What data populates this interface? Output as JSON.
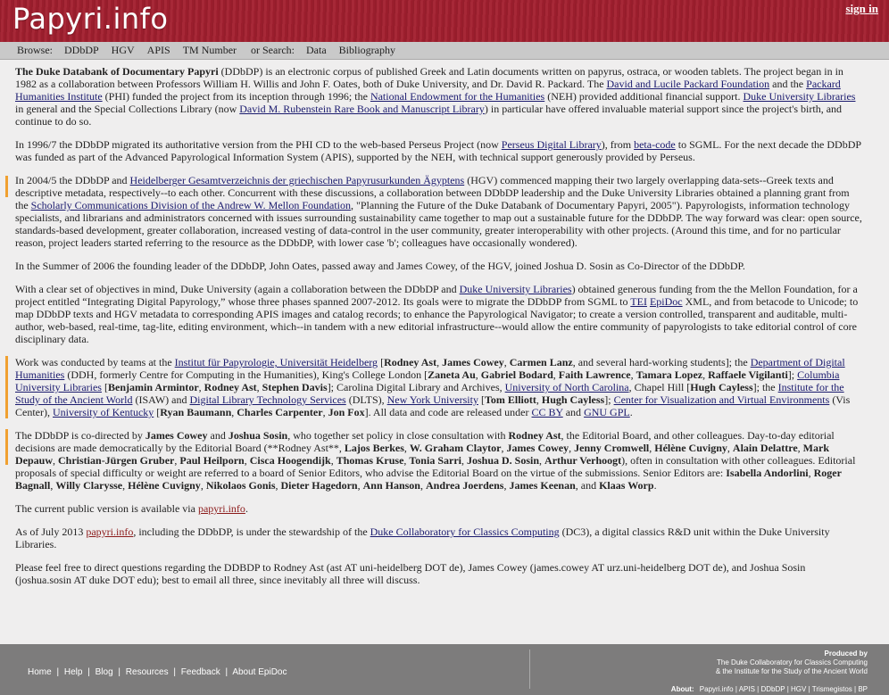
{
  "header": {
    "logo": "Papyri.info",
    "signin": "sign in"
  },
  "nav": {
    "browse_label": "Browse:",
    "items": [
      "DDbDP",
      "HGV",
      "APIS",
      "TM Number"
    ],
    "or_label": "or Search:",
    "search_items": [
      "Data",
      "Bibliography"
    ]
  },
  "content": {
    "p1": {
      "t0": "The Duke Databank of Documentary Papyri",
      "t1": " (DDbDP) is an electronic corpus of published Greek and Latin documents written on papyrus, ostraca, or wooden tablets. The project began in in 1982 as a collaboration between Professors William H. Willis and John F. Oates, both of Duke University, and Dr. David R. Packard. The ",
      "l1": "David and Lucile Packard Foundation",
      "t2": " and the ",
      "l2": "Packard Humanities Institute",
      "t3": " (PHI) funded the project from its inception through 1996; the ",
      "l3": "National Endowment for the Humanities",
      "t4": " (NEH) provided additional financial support. ",
      "l4": "Duke University Libraries",
      "t5": " in general and the Special Collections Library (now ",
      "l5": "David M. Rubenstein Rare Book and Manuscript Library",
      "t6": ") in particular have offered invaluable material support since the project's birth, and continue to do so."
    },
    "p2": {
      "t0": "In 1996/7 the DDbDP migrated its authoritative version from the PHI CD to the web-based Perseus Project (now ",
      "l1": "Perseus Digital Library",
      "t1": "), from ",
      "l2": "beta-code",
      "t2": " to SGML. For the next decade the DDbDP was funded as part of the Advanced Papyrological Information System (APIS), supported by the NEH, with technical support generously provided by Perseus."
    },
    "p3": {
      "t0": "In 2004/5 the DDbDP and ",
      "l1": "Heidelberger Gesamtverzeichnis der griechischen Papyrusurkunden Ägyptens",
      "t1": " (HGV) commenced mapping their two largely overlapping data-sets--Greek texts and descriptive metadata, respectively--to each other. Concurrent with these discussions, a collaboration between DDbDP leadership and the Duke University Libraries obtained a planning grant from the ",
      "l2": "Scholarly Communications Division of the Andrew W. Mellon Foundation",
      "t2": ", \"Planning the Future of the Duke Databank of Documentary Papyri, 2005\"). Papyrologists, information technology specialists, and librarians and administrators concerned with issues surrounding sustainability came together to map out a sustainable future for the DDbDP. The way forward was clear: open source, standards-based development, greater collaboration, increased vesting of data-control in the user community, greater interoperability with other projects. (Around this time, and for no particular reason, project leaders started referring to the resource as the DDbDP, with lower case 'b'; colleagues have occasionally wondered)."
    },
    "p4": "In the Summer of 2006 the founding leader of the DDbDP, John Oates, passed away and James Cowey, of the HGV, joined Joshua D. Sosin as Co-Director of the DDbDP.",
    "p5": {
      "t0": "With a clear set of objectives in mind, Duke University (again a collaboration between the DDbDP and ",
      "l1": "Duke University Libraries",
      "t1": ") obtained generous funding from the the Mellon Foundation, for a project entitled “Integrating Digital Papyrology,” whose three phases spanned 2007-2012. Its goals were to migrate the DDbDP from SGML to ",
      "l2": "TEI",
      "t2": " ",
      "l3": "EpiDoc",
      "t3": " XML, and from betacode to Unicode; to map DDbDP texts and HGV metadata to corresponding APIS images and catalog records; to enhance the Papyrological Navigator; to create a version controlled, transparent and auditable, multi-author, web-based, real-time, tag-lite, editing environment, which--in tandem with a new editorial infrastructure--would allow the entire community of papyrologists to take editorial control of core disciplinary data."
    },
    "p6": {
      "t0": "Work was conducted by teams at the ",
      "l1": "Institut für Papyrologie, Universität Heidelberg",
      "t1": " [",
      "b1": "Rodney Ast",
      "t2": ", ",
      "b2": "James Cowey",
      "t3": ", ",
      "b3": "Carmen Lanz",
      "t4": ", and several hard-working students]; the ",
      "l2": "Department of Digital Humanities",
      "t5": " (DDH, formerly Centre for Computing in the Humanities), King's College London [",
      "b4": "Zaneta Au",
      "t6": ", ",
      "b5": "Gabriel Bodard",
      "t7": ", ",
      "b6": "Faith Lawrence",
      "t8": ", ",
      "b7": "Tamara Lopez",
      "t9": ", ",
      "b8": "Raffaele Vigilanti",
      "t10": "]; ",
      "l3": "Columbia University Libraries",
      "t11": " [",
      "b9": "Benjamin Armintor",
      "t12": ", ",
      "b10": "Rodney Ast",
      "t13": ", ",
      "b11": "Stephen Davis",
      "t14": "]; Carolina Digital Library and Archives, ",
      "l4": "University of North Carolina",
      "t15": ", Chapel Hill [",
      "b12": "Hugh Cayless",
      "t16": "]; the ",
      "l5": "Institute for the Study of the Ancient World",
      "t17": " (ISAW) and ",
      "l6": "Digital Library Technology Services",
      "t18": " (DLTS), ",
      "l7": "New York University",
      "t19": " [",
      "b13": "Tom Elliott",
      "t20": ", ",
      "b14": "Hugh Cayless",
      "t21": "]; ",
      "l8": "Center for Visualization and Virtual Environments",
      "t22": " (Vis Center), ",
      "l9": "University of Kentucky",
      "t23": " [",
      "b15": "Ryan Baumann",
      "t24": ", ",
      "b16": "Charles Carpenter",
      "t25": ", ",
      "b17": "Jon Fox",
      "t26": "]. All data and code are released under ",
      "l10": "CC BY",
      "t27": " and ",
      "l11": "GNU GPL",
      "t28": "."
    },
    "p7": {
      "t0": "The DDbDP is co-directed by ",
      "b1": "James Cowey",
      "t1": " and ",
      "b2": "Joshua Sosin",
      "t2": ", who together set policy in close consultation with ",
      "b3": "Rodney Ast",
      "t3": ", the Editorial Board, and other colleagues. Day-to-day editorial decisions are made democratically by the Editorial Board (**Rodney Ast**, ",
      "b4": "Lajos Berkes",
      "t4": ", ",
      "b5": "W. Graham Claytor",
      "t5": ", ",
      "b6": "James Cowey",
      "t6": ", ",
      "b7": "Jenny Cromwell",
      "t7": ", ",
      "b8": "Hélène Cuvigny",
      "t8": ", ",
      "b9": "Alain Delattre",
      "t9": ", ",
      "b10": "Mark Depauw",
      "t10": ", ",
      "b11": "Christian-Jürgen Gruber",
      "t11": ", ",
      "b12": "Paul Heilporn",
      "t12": ", ",
      "b13": "Cisca Hoogendijk",
      "t13": ", ",
      "b14": "Thomas Kruse",
      "t14": ", ",
      "b15": "Tonia Sarri",
      "t15": ", ",
      "b16": "Joshua D. Sosin",
      "t16": ", ",
      "b17": "Arthur Verhoogt",
      "t17": "), often in consultation with other colleagues. Editorial proposals of special difficulty or weight are referred to a board of Senior Editors, who advise the Editorial Board on the virtue of the submissions. Senior Editors are: ",
      "b18": "Isabella Andorlini",
      "t18": ", ",
      "b19": "Roger Bagnall",
      "t19": ", ",
      "b20": "Willy Clarysse",
      "t20": ", ",
      "b21": "Hélène Cuvigny",
      "t21": ", ",
      "b22": "Nikolaos Gonis",
      "t22": ", ",
      "b23": "Dieter Hagedorn",
      "t23": ", ",
      "b24": "Ann Hanson",
      "t24": ", ",
      "b25": "Andrea Joerdens",
      "t25": ", ",
      "b26": "James Keenan",
      "t26": ", and ",
      "b27": "Klaas Worp",
      "t27": "."
    },
    "p8": {
      "t0": "The current public version is available via ",
      "l1": "papyri.info",
      "t1": "."
    },
    "p9": {
      "t0": "As of July 2013 ",
      "l1": "papyri.info",
      "t1": ", including the DDbDP, is under the stewardship of the ",
      "l2": "Duke Collaboratory for Classics Computing",
      "t2": " (DC3), a digital classics R&D unit within the Duke University Libraries."
    },
    "p10": "Please feel free to direct questions regarding the DDBDP to Rodney Ast (ast AT uni-heidelberg DOT de), James Cowey (james.cowey AT urz.uni-heidelberg DOT de), and Joshua Sosin (joshua.sosin AT duke DOT edu); best to email all three, since inevitably all three will discuss."
  },
  "footer": {
    "links": [
      "Home",
      "Help",
      "Blog",
      "Resources",
      "Feedback",
      "About EpiDoc"
    ],
    "sep": "|",
    "produced_by": "Produced by",
    "produced_l1": "The Duke Collaboratory for Classics Computing",
    "produced_l2": "& the Institute for the Study of the Ancient World",
    "about_label": "About:",
    "about_items": [
      "Papyri.info",
      "APIS",
      "DDbDP",
      "HGV",
      "Trismegistos",
      "BP"
    ]
  }
}
